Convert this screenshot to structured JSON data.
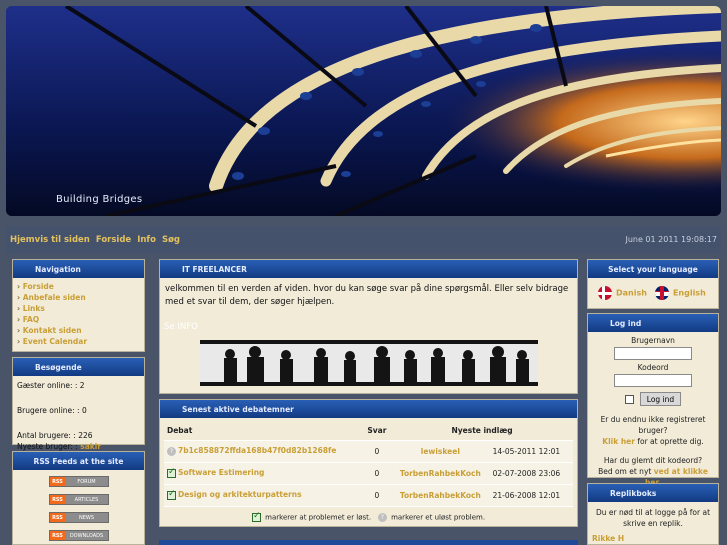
{
  "banner": {
    "title": "Building Bridges"
  },
  "topnav": {
    "links": [
      "Hjemvis til siden",
      "Forside",
      "Info",
      "Søg"
    ],
    "date": "June 01 2011 19:08:17"
  },
  "navigation": {
    "title": "Navigation",
    "items": [
      "Forside",
      "Anbefale siden",
      "Links",
      "FAQ",
      "Kontakt siden",
      "Event Calendar"
    ]
  },
  "visitors": {
    "title": "Besøgende",
    "guests": "Gæster online: : 2",
    "users": "Brugere online: : 0",
    "total": "Antal brugere: : 226",
    "newest_label": "Nyeste bruger: :",
    "newest_user": "sakir"
  },
  "rss": {
    "title": "RSS Feeds at the site",
    "feeds": [
      {
        "badge": "RSS",
        "label": "FORUM"
      },
      {
        "badge": "RSS",
        "label": "ARTICLES"
      },
      {
        "badge": "RSS",
        "label": "NEWS"
      },
      {
        "badge": "RSS",
        "label": "DOWNLOADS"
      }
    ]
  },
  "it_panel": {
    "title": "IT FREELANCER",
    "text": "velkommen til en verden af viden. hvor du kan søge svar på dine spørgsmål. Eller selv bidrage med et svar til dem, der søger hjælpen.",
    "info_link": "Se INFO"
  },
  "debates": {
    "title": "Senest aktive debatemner",
    "headers": [
      "Debat",
      "Svar",
      "Nyeste indlæg"
    ],
    "rows": [
      {
        "status": "question",
        "topic": "7b1c858872ffda168b47f0d82b1268fe",
        "replies": "0",
        "user": "lewiskeel",
        "date": "14-05-2011 12:01"
      },
      {
        "status": "solved",
        "topic": "Software Estimering",
        "replies": "0",
        "user": "TorbenRahbekKoch",
        "date": "02-07-2008 23:06"
      },
      {
        "status": "solved",
        "topic": "Design og arkitekturpatterns",
        "replies": "0",
        "user": "TorbenRahbekKoch",
        "date": "21-06-2008 12:01"
      }
    ],
    "legend_solved": "markerer at problemet er løst.",
    "legend_unsolved": "markerer et uløst problem."
  },
  "language": {
    "title": "Select your language",
    "options": [
      "Danish",
      "English"
    ]
  },
  "login": {
    "title": "Log ind",
    "username_label": "Brugernavn",
    "password_label": "Kodeord",
    "button": "Log ind",
    "not_registered": "Er du endnu ikke registreret bruger?",
    "click_here": "Klik her",
    "to_create": "for at oprette dig.",
    "forgot": "Har du glemt dit kodeord?",
    "request_new": "Bed om et nyt",
    "request_link": "ved at klikke her."
  },
  "replies": {
    "title": "Replikboks",
    "text": "Du er nød til at logge på for at skrive en replik.",
    "user": "Rikke H"
  }
}
